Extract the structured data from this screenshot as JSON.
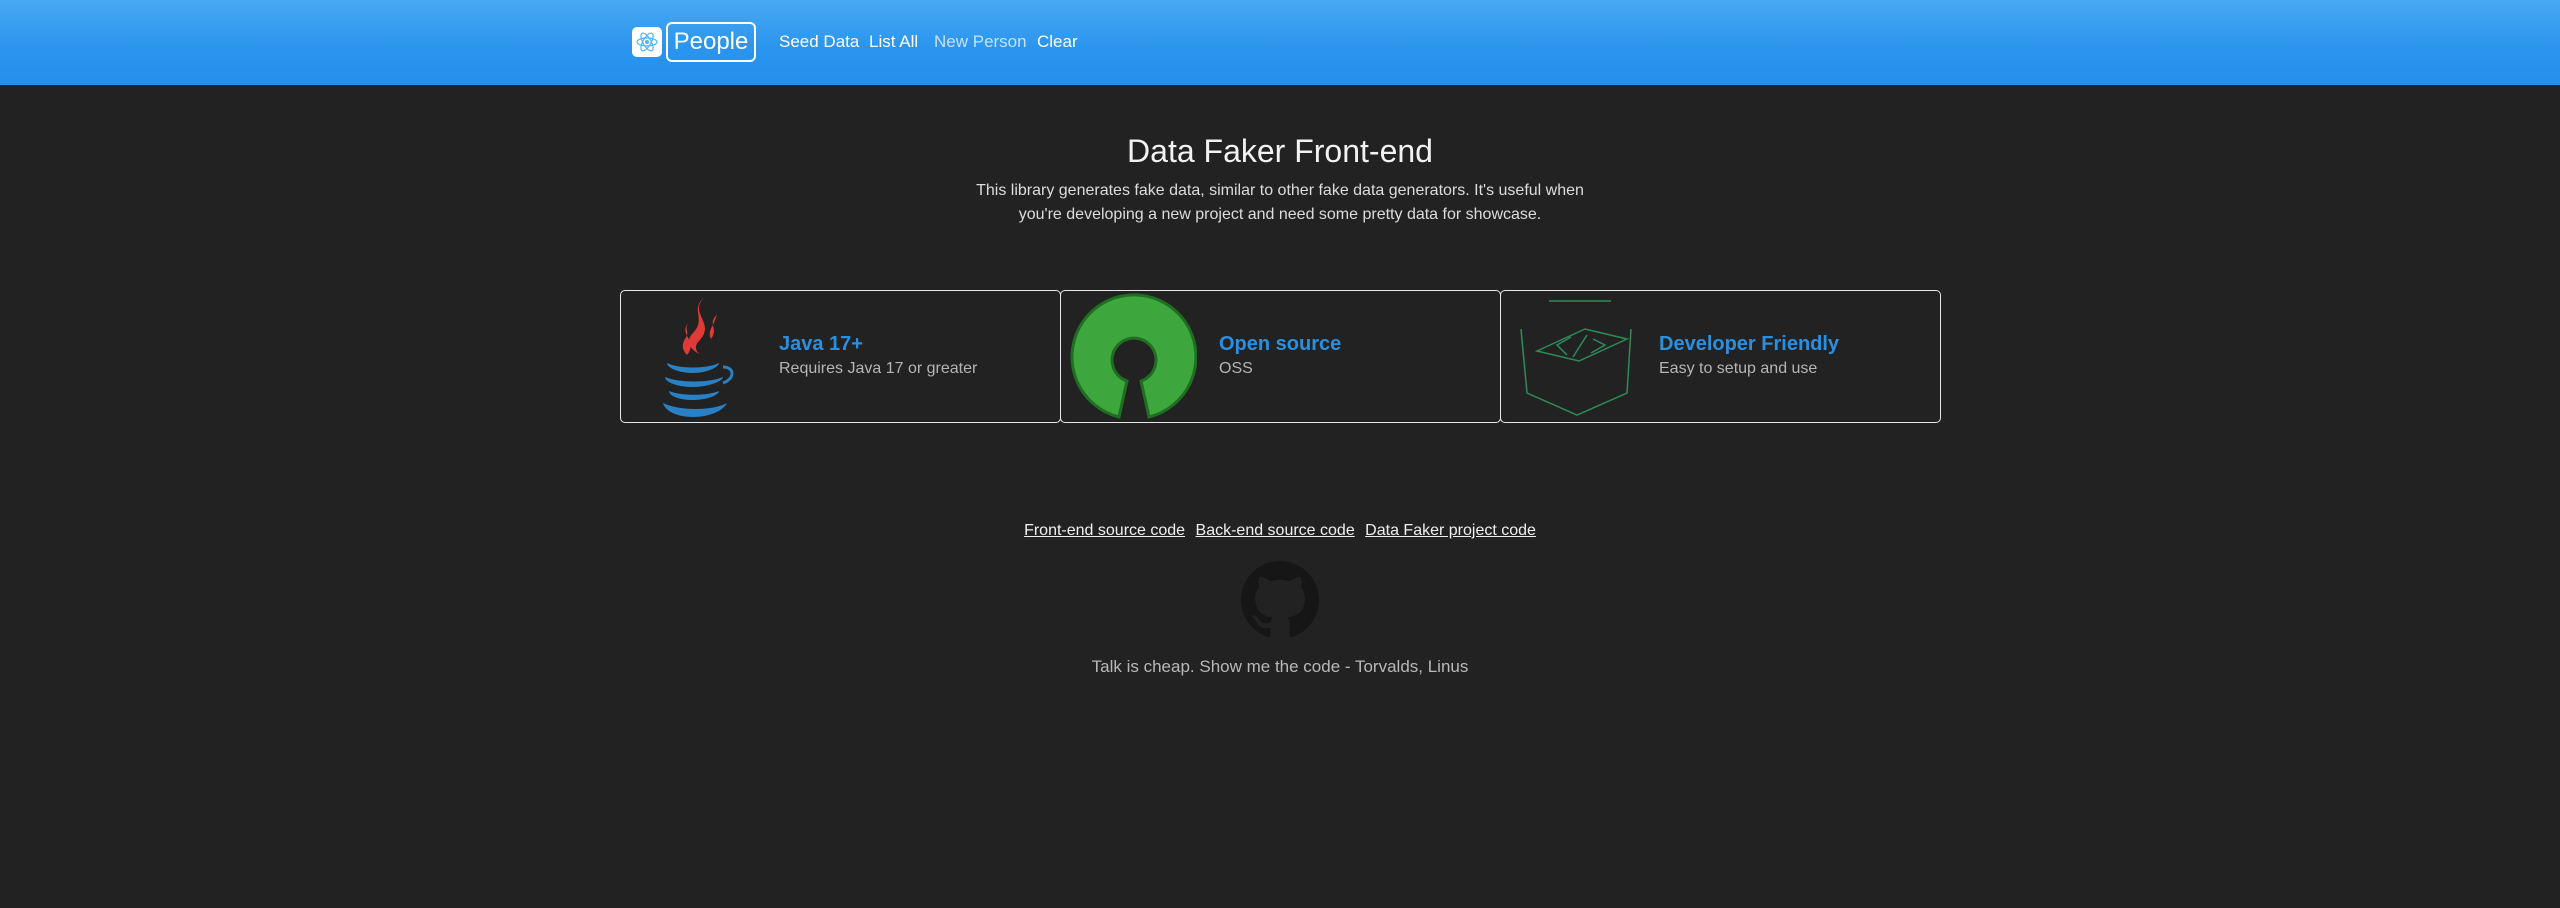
{
  "header": {
    "brand_icon": "react-atom-icon",
    "brand_name": "People",
    "nav": [
      {
        "label": "Seed Data",
        "active": true
      },
      {
        "label": "List All",
        "active": true
      },
      {
        "label": "New Person",
        "active": false
      },
      {
        "label": "Clear",
        "active": true
      }
    ],
    "colors": {
      "bar": "#2b95ee",
      "text": "#ffffff"
    }
  },
  "hero": {
    "title": "Data Faker Front-end",
    "description": "This library generates fake data, similar to other fake data generators. It's useful when you're developing a new project and need some pretty data for showcase."
  },
  "features": [
    {
      "icon": "java-logo-icon",
      "title": "Java 17+",
      "text": "Requires Java 17 or greater"
    },
    {
      "icon": "open-source-logo-icon",
      "title": "Open source",
      "text": "OSS"
    },
    {
      "icon": "code-cube-icon",
      "title": "Developer Friendly",
      "text": "Easy to setup and use"
    }
  ],
  "footer": {
    "links": [
      "Front-end source code",
      "Back-end source code",
      "Data Faker project code"
    ],
    "github_icon": "github-octocat-icon",
    "quote": "Talk is cheap. Show me the code - Torvalds, Linus"
  },
  "colors": {
    "background": "#222222",
    "accent": "#2b8fe0",
    "card_border": "#e6e6e6"
  }
}
